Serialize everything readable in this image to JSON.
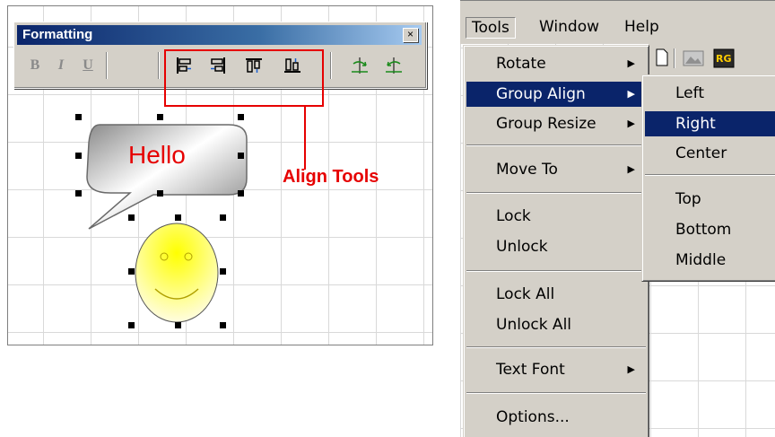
{
  "formatting": {
    "title": "Formatting",
    "close_glyph": "×",
    "bold": "B",
    "italic": "I",
    "underline": "U",
    "icons": [
      "align-left-icon",
      "align-right-icon",
      "align-top-icon",
      "align-bottom-icon",
      "rotate-right-icon",
      "rotate-left-icon"
    ]
  },
  "annotation": {
    "label": "Align Tools",
    "color": "#e60000"
  },
  "canvas": {
    "hello": "Hello"
  },
  "menubar": {
    "tools": "Tools",
    "window": "Window",
    "help": "Help"
  },
  "tools_menu": {
    "rotate": "Rotate",
    "group_align": "Group Align",
    "group_resize": "Group Resize",
    "move_to": "Move To",
    "lock": "Lock",
    "unlock": "Unlock",
    "lock_all": "Lock All",
    "unlock_all": "Unlock All",
    "text_font": "Text Font",
    "options": "Options..."
  },
  "group_align_menu": {
    "left": "Left",
    "right": "Right",
    "center": "Center",
    "top": "Top",
    "bottom": "Bottom",
    "middle": "Middle"
  },
  "colors": {
    "highlight": "#0a246a",
    "menu_bg": "#d4d0c8",
    "accent": "#e60000"
  }
}
